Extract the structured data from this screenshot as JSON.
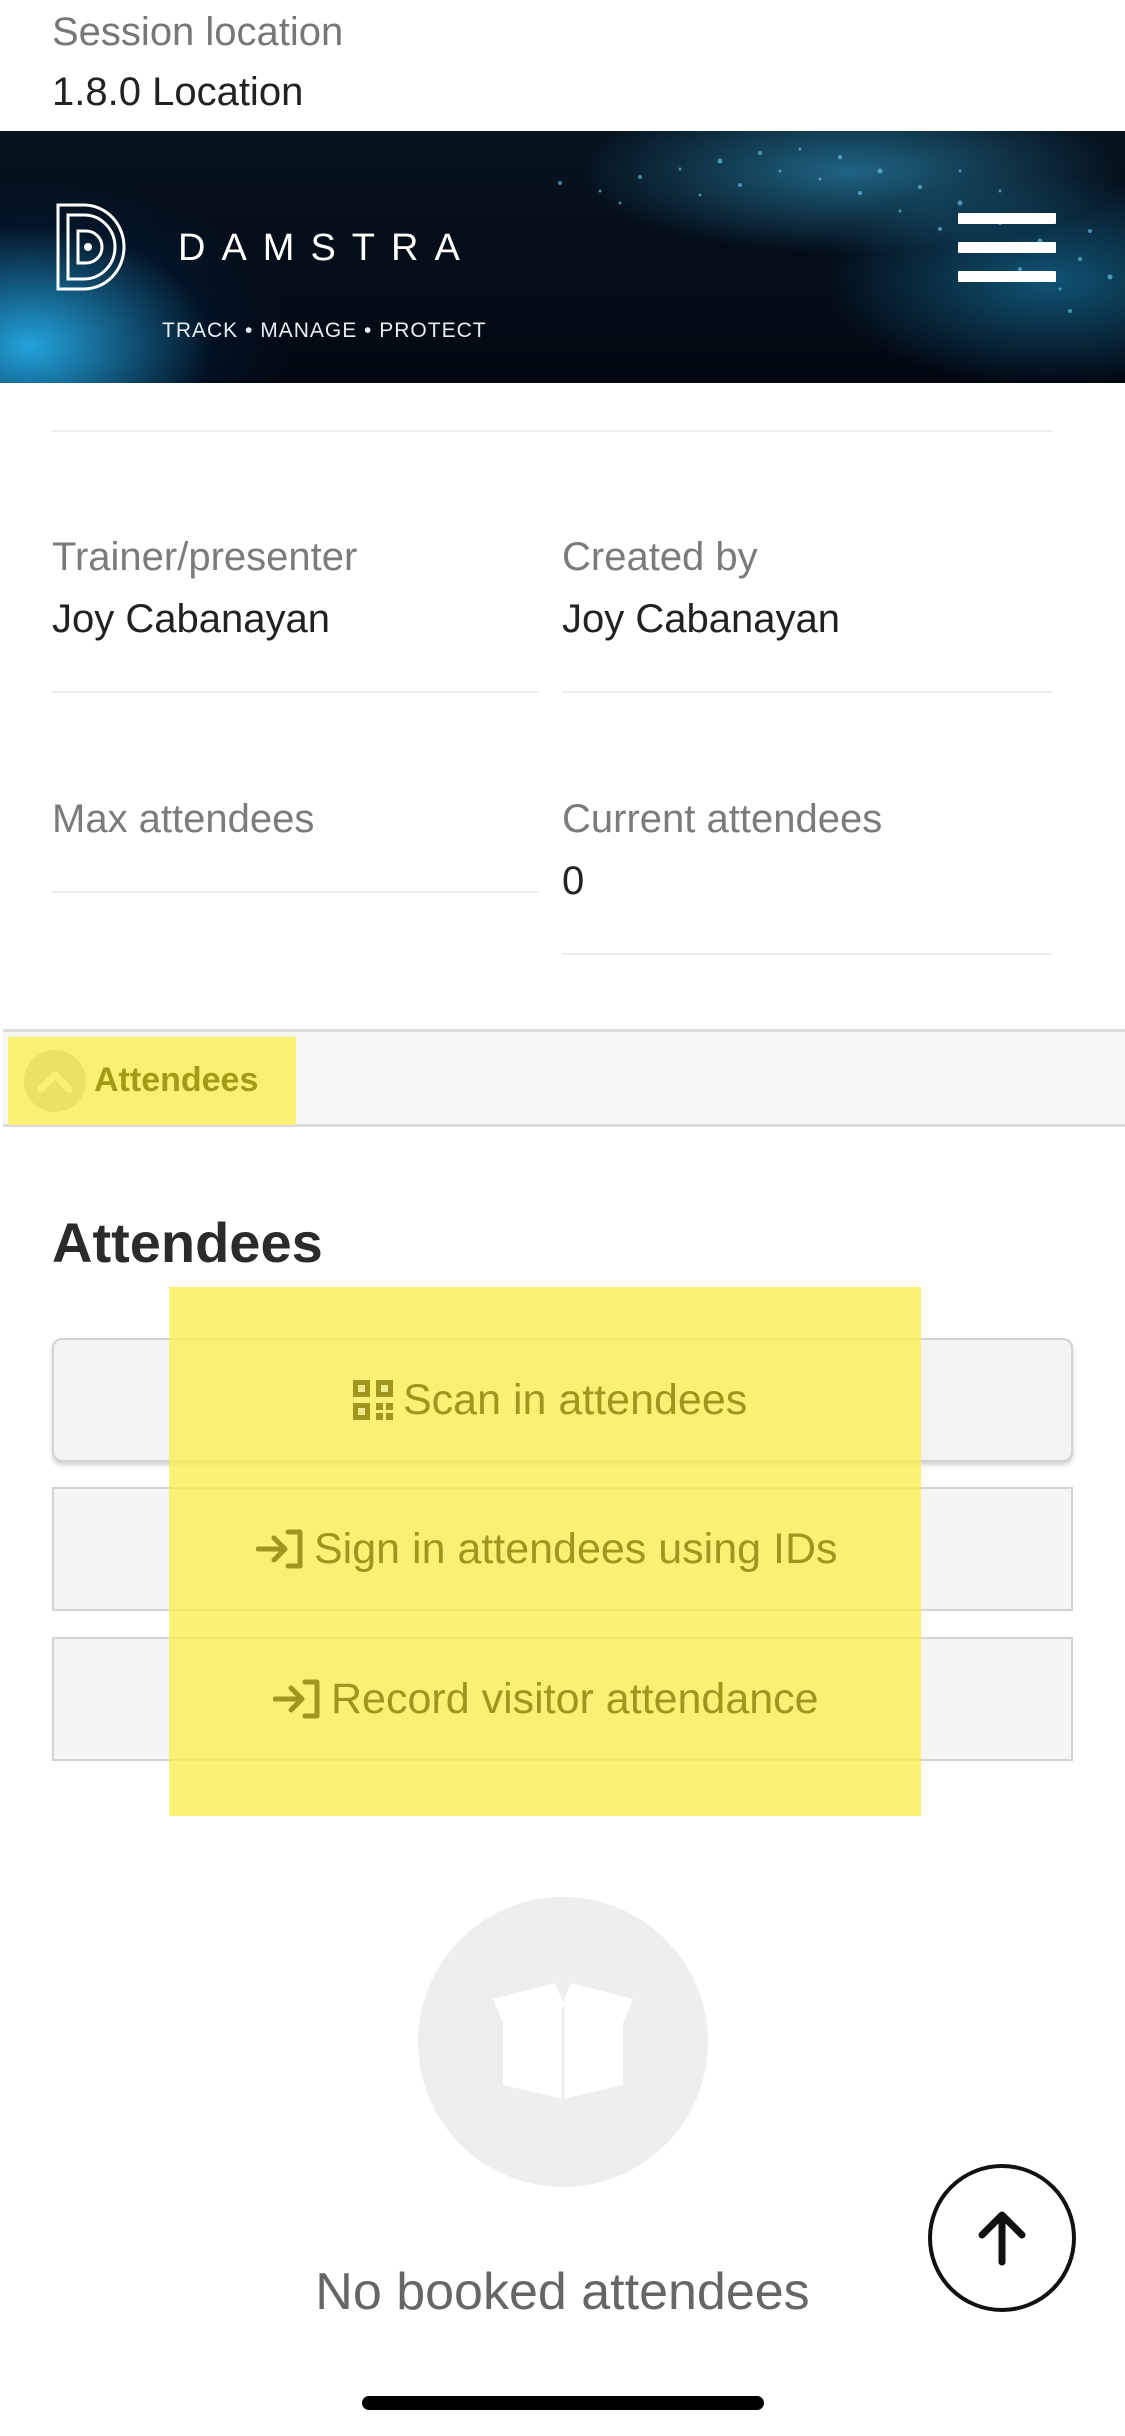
{
  "session": {
    "location_label": "Session location",
    "location_value": "1.8.0 Location"
  },
  "header": {
    "brand": "DAMSTRA",
    "tagline": "TRACK • MANAGE • PROTECT",
    "menu_icon": "hamburger-menu-icon"
  },
  "fields": {
    "trainer_label": "Trainer/presenter",
    "trainer_value": "Joy Cabanayan",
    "created_label": "Created by",
    "created_value": "Joy Cabanayan",
    "max_label": "Max attendees",
    "max_value": "",
    "current_label": "Current attendees",
    "current_value": "0"
  },
  "section": {
    "toggle_label": "Attendees",
    "toggle_icon": "chevron-up-icon",
    "heading": "Attendees"
  },
  "actions": {
    "scan_label": "Scan in attendees",
    "scan_icon": "qr-code-icon",
    "sign_in_label": "Sign in attendees using IDs",
    "sign_in_icon": "sign-in-arrow-icon",
    "visitor_label": "Record visitor attendance",
    "visitor_icon": "sign-in-arrow-icon"
  },
  "empty_state": {
    "icon": "open-box-icon",
    "text": "No booked attendees"
  },
  "scroll_top_icon": "arrow-up-icon",
  "colors": {
    "highlight": "#faee50",
    "highlight_text": "#9f961b",
    "header_bg": "#06131f",
    "accent_blue": "#28beff"
  }
}
